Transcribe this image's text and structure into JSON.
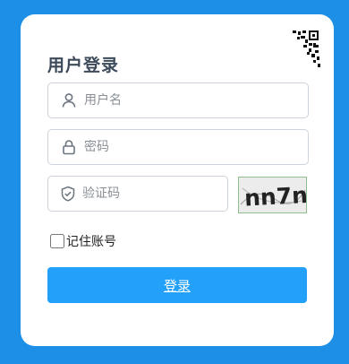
{
  "login": {
    "title": "用户登录",
    "username": {
      "placeholder": "用户名",
      "value": ""
    },
    "password": {
      "placeholder": "密码",
      "value": ""
    },
    "captcha": {
      "placeholder": "验证码",
      "value": "",
      "image_text": "nn7n"
    },
    "remember_label": "记住账号",
    "remember_checked": false,
    "submit_label": "登录"
  },
  "colors": {
    "background": "#1e8fe6",
    "card": "#ffffff",
    "button": "#22a0fa",
    "title": "#3c4a5a"
  },
  "icons": [
    "qr-code-icon",
    "user-icon",
    "lock-icon",
    "shield-check-icon"
  ]
}
